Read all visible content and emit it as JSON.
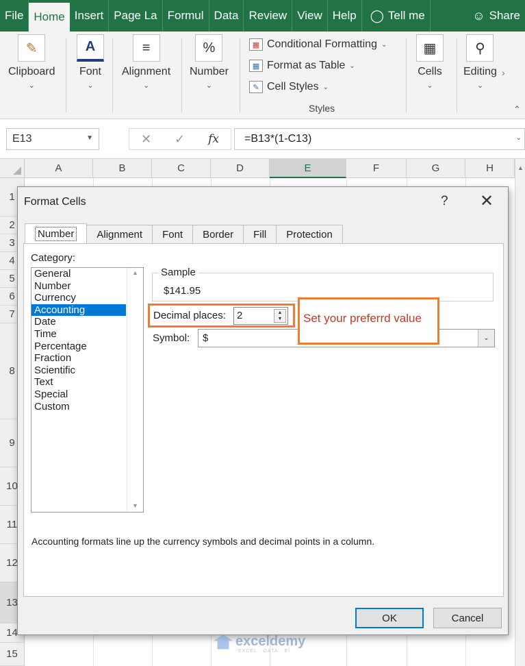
{
  "ribbon_tabs": [
    {
      "label": "File"
    },
    {
      "label": "Home"
    },
    {
      "label": "Insert"
    },
    {
      "label": "Page La"
    },
    {
      "label": "Formul"
    },
    {
      "label": "Data"
    },
    {
      "label": "Review"
    },
    {
      "label": "View"
    },
    {
      "label": "Help"
    }
  ],
  "tell_me": "Tell me",
  "share": "Share",
  "groups": {
    "clipboard": "Clipboard",
    "font": "Font",
    "alignment": "Alignment",
    "number": "Number",
    "cells": "Cells",
    "editing": "Editing",
    "styles": "Styles",
    "number_icon": "%"
  },
  "styles_items": {
    "conditional": "Conditional Formatting",
    "format_table": "Format as Table",
    "cell_styles": "Cell Styles"
  },
  "formula_bar": {
    "name_box": "E13",
    "formula": "=B13*(1-C13)",
    "fx": "fx"
  },
  "columns": [
    "A",
    "B",
    "C",
    "D",
    "E",
    "F",
    "G",
    "H"
  ],
  "rows": [
    "1",
    "2",
    "3",
    "4",
    "5",
    "6",
    "7",
    "8",
    "9",
    "10",
    "11",
    "12",
    "13",
    "14",
    "15"
  ],
  "dialog": {
    "title": "Format Cells",
    "help": "?",
    "tabs": [
      "Number",
      "Alignment",
      "Font",
      "Border",
      "Fill",
      "Protection"
    ],
    "category_label": "Category:",
    "categories": [
      "General",
      "Number",
      "Currency",
      "Accounting",
      "Date",
      "Time",
      "Percentage",
      "Fraction",
      "Scientific",
      "Text",
      "Special",
      "Custom"
    ],
    "selected_category": "Accounting",
    "sample_label": "Sample",
    "sample_value": "$141.95",
    "decimal_label": "Decimal places:",
    "decimal_value": "2",
    "symbol_label": "Symbol:",
    "symbol_value": "$",
    "description": "Accounting formats line up the currency symbols and decimal points in a column.",
    "ok": "OK",
    "cancel": "Cancel"
  },
  "callout": "Set your preferrd value",
  "watermark": {
    "name": "exceldemy",
    "sub": "EXCEL · DATA · BI"
  },
  "colors": {
    "excel_green": "#217346",
    "highlight": "#ed7d31",
    "selection": "#0078d7"
  }
}
